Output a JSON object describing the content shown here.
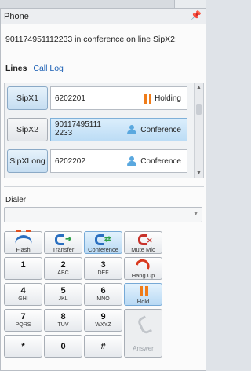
{
  "panel": {
    "title": "Phone",
    "pin_glyph": "📌",
    "status": "901174951112233 in conference on line SipX2:"
  },
  "tabs": {
    "lines": "Lines",
    "call_log": "Call Log"
  },
  "lines": [
    {
      "button": "SipX1",
      "number": "6202201",
      "state": "Holding",
      "state_icon": "hold-icon",
      "highlighted": true
    },
    {
      "button": "SipX2",
      "number_line1": "90117495111",
      "number_line2": "2233",
      "state": "Conference",
      "state_icon": "person-icon",
      "highlighted": false
    },
    {
      "button": "SipXLong",
      "number": "6202202",
      "state": "Conference",
      "state_icon": "person-icon",
      "highlighted": false
    }
  ],
  "dialer": {
    "label": "Dialer:",
    "value": ""
  },
  "keypad": {
    "actions": [
      {
        "label": "Flash",
        "icon": "flash-icon"
      },
      {
        "label": "Transfer",
        "icon": "transfer-icon"
      },
      {
        "label": "Conference",
        "icon": "conference-icon"
      },
      {
        "label": "Mute Mic",
        "icon": "mute-mic-icon"
      }
    ],
    "hang_up": "Hang Up",
    "hold": "Hold",
    "answer": "Answer",
    "keys": [
      {
        "digit": "1",
        "letters": ""
      },
      {
        "digit": "2",
        "letters": "ABC"
      },
      {
        "digit": "3",
        "letters": "DEF"
      },
      {
        "digit": "4",
        "letters": "GHI"
      },
      {
        "digit": "5",
        "letters": "JKL"
      },
      {
        "digit": "6",
        "letters": "MNO"
      },
      {
        "digit": "7",
        "letters": "PQRS"
      },
      {
        "digit": "8",
        "letters": "TUV"
      },
      {
        "digit": "9",
        "letters": "WXYZ"
      },
      {
        "digit": "*",
        "letters": ""
      },
      {
        "digit": "0",
        "letters": ""
      },
      {
        "digit": "#",
        "letters": ""
      }
    ]
  }
}
